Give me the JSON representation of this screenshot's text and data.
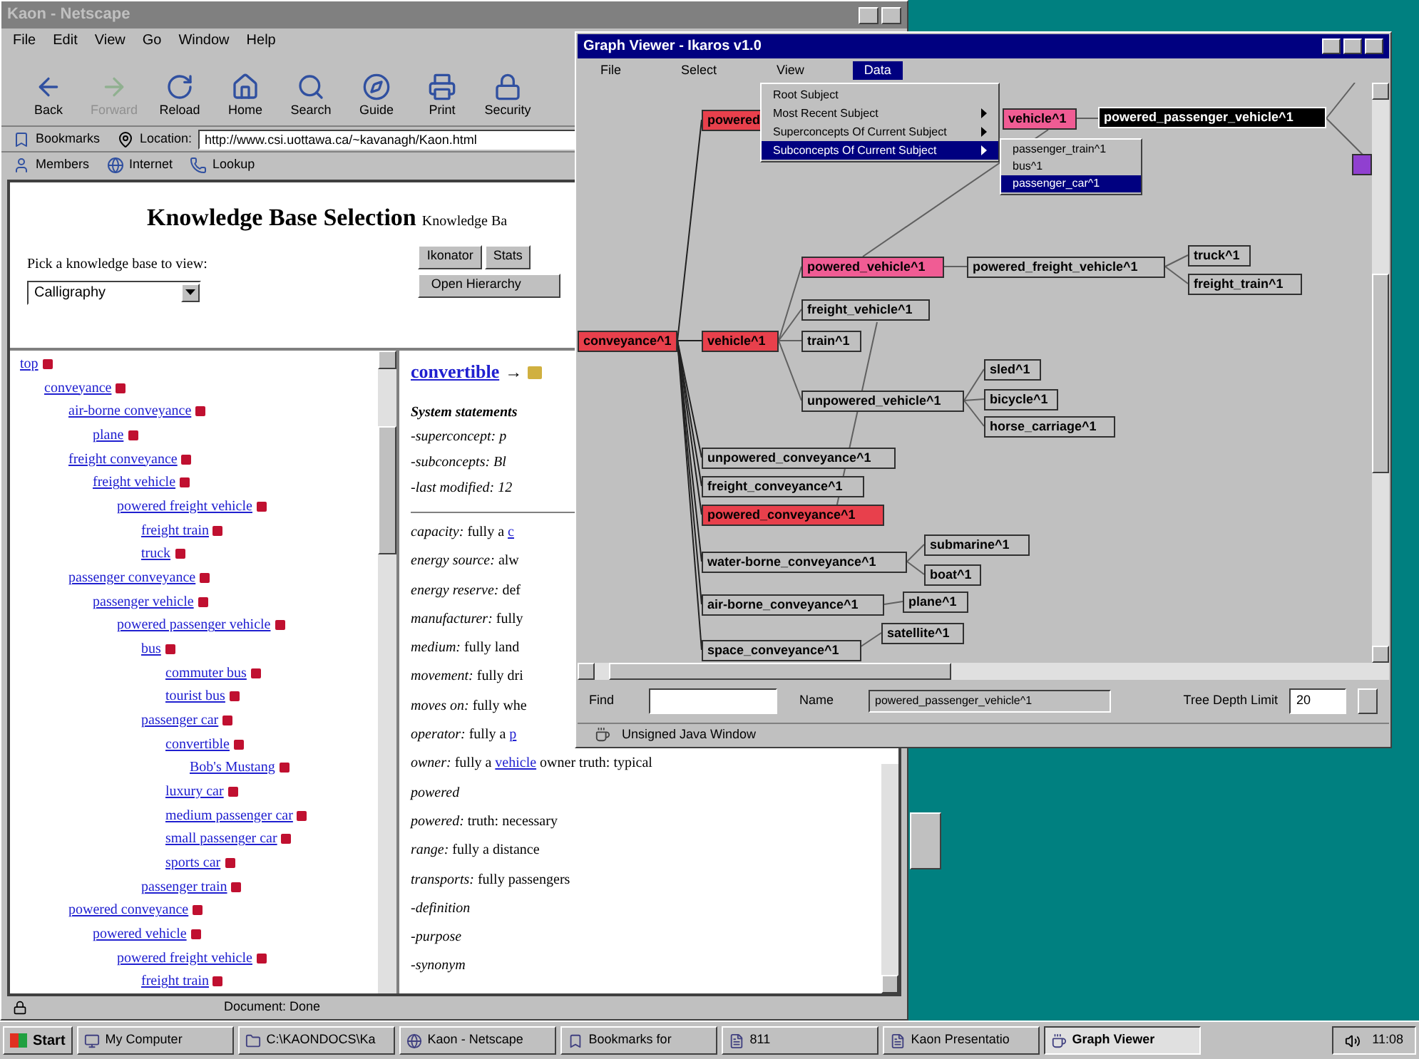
{
  "browser": {
    "title": "Kaon - Netscape",
    "menu": [
      "File",
      "Edit",
      "View",
      "Go",
      "Window",
      "Help"
    ],
    "toolbar": [
      {
        "label": "Back",
        "disabled": false
      },
      {
        "label": "Forward",
        "disabled": true
      },
      {
        "label": "Reload",
        "disabled": false
      },
      {
        "label": "Home",
        "disabled": false
      },
      {
        "label": "Search",
        "disabled": false
      },
      {
        "label": "Guide",
        "disabled": false
      },
      {
        "label": "Print",
        "disabled": false
      },
      {
        "label": "Security",
        "disabled": false
      }
    ],
    "bookmarks_label": "Bookmarks",
    "location_label": "Location:",
    "url": "http://www.csi.uottawa.ca/~kavanagh/Kaon.html",
    "personal": [
      "Members",
      "Internet",
      "Lookup"
    ],
    "status": "Document: Done"
  },
  "selection": {
    "title": "Knowledge Base Selection",
    "subtitle": "Knowledge Ba",
    "prompt": "Pick a knowledge base to view:",
    "choice": "Calligraphy",
    "buttons": [
      "Ikonator",
      "Stats"
    ],
    "wide_button": "Open Hierarchy"
  },
  "tree": [
    {
      "label": "top",
      "children": [
        {
          "label": "conveyance",
          "children": [
            {
              "label": "air-borne conveyance",
              "children": [
                {
                  "label": "plane"
                }
              ]
            },
            {
              "label": "freight conveyance",
              "children": [
                {
                  "label": "freight vehicle",
                  "children": [
                    {
                      "label": "powered freight vehicle",
                      "children": [
                        {
                          "label": "freight train"
                        },
                        {
                          "label": "truck"
                        }
                      ]
                    }
                  ]
                }
              ]
            },
            {
              "label": "passenger conveyance",
              "children": [
                {
                  "label": "passenger vehicle",
                  "children": [
                    {
                      "label": "powered passenger vehicle",
                      "children": [
                        {
                          "label": "bus",
                          "children": [
                            {
                              "label": "commuter bus"
                            },
                            {
                              "label": "tourist bus"
                            }
                          ]
                        },
                        {
                          "label": "passenger car",
                          "children": [
                            {
                              "label": "convertible",
                              "children": [
                                {
                                  "label": "Bob's Mustang"
                                }
                              ]
                            },
                            {
                              "label": "luxury car"
                            },
                            {
                              "label": "medium passenger car"
                            },
                            {
                              "label": "small passenger car"
                            },
                            {
                              "label": "sports car"
                            }
                          ]
                        },
                        {
                          "label": "passenger train"
                        }
                      ]
                    }
                  ]
                }
              ]
            },
            {
              "label": "powered conveyance",
              "children": [
                {
                  "label": "powered vehicle",
                  "children": [
                    {
                      "label": "powered freight vehicle",
                      "children": [
                        {
                          "label": "freight train"
                        }
                      ]
                    }
                  ]
                }
              ]
            }
          ]
        }
      ]
    }
  ],
  "concept": {
    "title": "convertible",
    "arrow": "→",
    "section": "System statements",
    "system_lines": [
      "-superconcept: p",
      "-subconcepts: Bl",
      "-last modified: 12"
    ],
    "property_lines": [
      {
        "text": "*capacity:* fully a ",
        "link": "c"
      },
      {
        "text": "*energy source:* alw"
      },
      {
        "text": "*energy reserve:* def"
      },
      {
        "text": "*manufacturer:* fully"
      },
      {
        "text": "*medium:* fully land"
      },
      {
        "text": "*movement:* fully dri"
      },
      {
        "text": "*moves on:* fully whe"
      },
      {
        "text": "*operator:* fully a ",
        "link": "p"
      },
      {
        "text": "*owner:* fully a ",
        "link": "vehicle",
        "after": " owner truth: typical"
      },
      {
        "text": "*powered*"
      },
      {
        "text": "*powered:* truth: necessary"
      },
      {
        "text": "*range:* fully a distance"
      },
      {
        "text": "*transports:* fully passengers"
      },
      {
        "text": "*-definition*"
      },
      {
        "text": "*-purpose*"
      },
      {
        "text": "*-synonym*"
      }
    ]
  },
  "graph": {
    "title": "Graph Viewer - Ikaros v1.0",
    "menu": [
      {
        "label": "File",
        "selected": false
      },
      {
        "label": "Select",
        "selected": false
      },
      {
        "label": "View",
        "selected": false
      },
      {
        "label": "Data",
        "selected": true
      }
    ],
    "dropdown": [
      {
        "label": "Root Subject",
        "submenu": false,
        "selected": false
      },
      {
        "label": "Most Recent Subject",
        "submenu": true,
        "selected": false
      },
      {
        "label": "Superconcepts Of Current Subject",
        "submenu": true,
        "selected": false
      },
      {
        "label": "Subconcepts Of Current Subject",
        "submenu": true,
        "selected": true
      }
    ],
    "submenu": [
      {
        "label": "passenger_train^1",
        "selected": false
      },
      {
        "label": "bus^1",
        "selected": false
      },
      {
        "label": "passenger_car^1",
        "selected": true
      }
    ],
    "nodes": [
      {
        "label": "conveyance^1",
        "color": "#e8404c",
        "selected": false
      },
      {
        "label": "powered",
        "color": "#e8404c",
        "selected": false
      },
      {
        "label": "vehicle^1",
        "color": "#e8404c",
        "selected": false
      },
      {
        "label": "vehicle^1",
        "color": "#f05c94",
        "selected": false
      },
      {
        "label": "powered_passenger_vehicle^1",
        "color": "#000000",
        "selected": true
      },
      {
        "color": "#9040d0",
        "selected": false
      },
      {
        "label": "powered_vehicle^1",
        "color": "#f05c94",
        "selected": false
      },
      {
        "label": "powered_freight_vehicle^1",
        "color": "#c0c0c0",
        "selected": false
      },
      {
        "label": "truck^1",
        "color": "#c0c0c0",
        "selected": false
      },
      {
        "label": "freight_train^1",
        "color": "#c0c0c0",
        "selected": false
      },
      {
        "label": "freight_vehicle^1",
        "color": "#c0c0c0",
        "selected": false
      },
      {
        "label": "train^1",
        "color": "#c0c0c0",
        "selected": false
      },
      {
        "label": "sled^1",
        "color": "#c0c0c0",
        "selected": false
      },
      {
        "label": "unpowered_vehicle^1",
        "color": "#c0c0c0",
        "selected": false
      },
      {
        "label": "bicycle^1",
        "color": "#c0c0c0",
        "selected": false
      },
      {
        "label": "horse_carriage^1",
        "color": "#c0c0c0",
        "selected": false
      },
      {
        "label": "unpowered_conveyance^1",
        "color": "#c0c0c0",
        "selected": false
      },
      {
        "label": "freight_conveyance^1",
        "color": "#c0c0c0",
        "selected": false
      },
      {
        "label": "powered_conveyance^1",
        "color": "#e8404c",
        "selected": false
      },
      {
        "label": "submarine^1",
        "color": "#c0c0c0",
        "selected": false
      },
      {
        "label": "water-borne_conveyance^1",
        "color": "#c0c0c0",
        "selected": false
      },
      {
        "label": "boat^1",
        "color": "#c0c0c0",
        "selected": false
      },
      {
        "label": "air-borne_conveyance^1",
        "color": "#c0c0c0",
        "selected": false
      },
      {
        "label": "plane^1",
        "color": "#c0c0c0",
        "selected": false
      },
      {
        "label": "satellite^1",
        "color": "#c0c0c0",
        "selected": false
      },
      {
        "label": "space_conveyance^1",
        "color": "#c0c0c0",
        "selected": false
      }
    ],
    "find_label": "Find",
    "name_label": "Name",
    "name_value": "powered_passenger_vehicle^1",
    "depth_label": "Tree Depth Limit",
    "depth_value": "20",
    "status": "Unsigned Java Window"
  },
  "taskbar": {
    "start": "Start",
    "items": [
      {
        "label": "My Computer",
        "selected": false
      },
      {
        "label": "C:\\KAONDOCS\\Ka",
        "selected": false
      },
      {
        "label": "Kaon - Netscape",
        "selected": false
      },
      {
        "label": "Bookmarks for",
        "selected": false
      },
      {
        "label": "811",
        "selected": false
      },
      {
        "label": "Kaon Presentatio",
        "selected": false
      },
      {
        "label": "Graph Viewer",
        "selected": true
      }
    ],
    "clock": "11:08"
  }
}
